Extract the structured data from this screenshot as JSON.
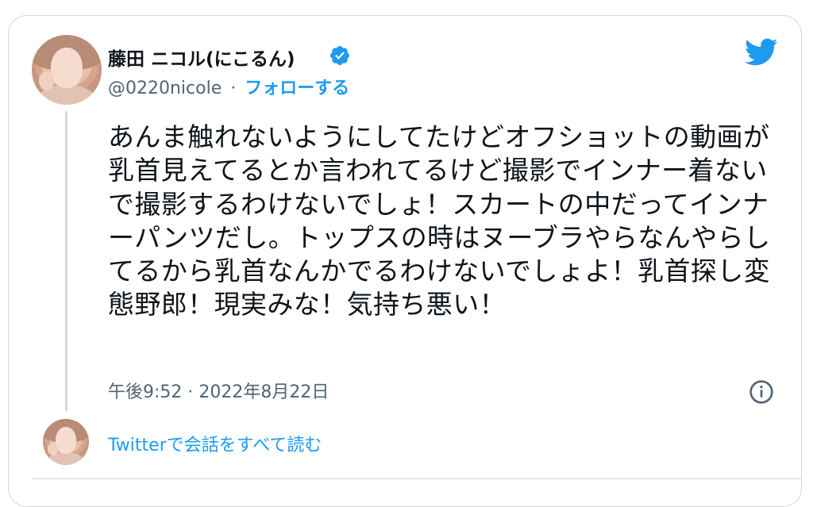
{
  "user": {
    "display_name": "藤田 ニコル(にこるん)",
    "handle": "@0220nicole",
    "follow_label": "フォローする",
    "separator": "·"
  },
  "tweet": {
    "text": "あんま触れないようにしてたけどオフショットの動画が乳首見えてるとか言われてるけど撮影でインナー着ないで撮影するわけないでしょ！スカートの中だってインナーパンツだし。トップスの時はヌーブラやらなんやらしてるから乳首なんかでるわけないでしょよ！乳首探し変態野郎！現実みな！気持ち悪い！",
    "timestamp": "午後9:52 · 2022年8月22日"
  },
  "footer": {
    "read_conversation": "Twitterで会話をすべて読む"
  },
  "icons": {
    "brand": "twitter-bird-icon",
    "verified": "verified-badge-icon",
    "info": "info-icon"
  },
  "colors": {
    "accent": "#1d9bf0",
    "text": "#0f1419",
    "muted": "#536471",
    "border": "#cfd9de"
  }
}
